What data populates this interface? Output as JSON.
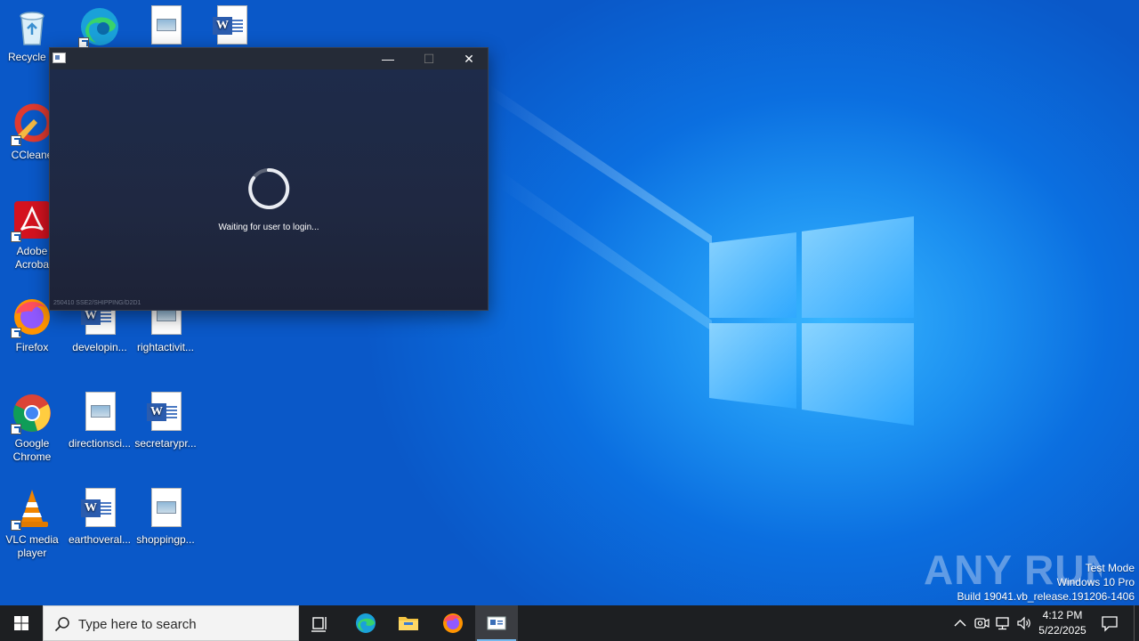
{
  "desktop": {
    "icons": [
      {
        "label": "Recycle Bin",
        "label_visible": "Recycle B"
      },
      {
        "label": "Microsoft Edge"
      },
      {
        "label": "",
        "type": "image-doc"
      },
      {
        "label": "",
        "type": "word-doc"
      },
      {
        "label": "CCleaner",
        "label_visible": "CCleane"
      },
      {
        "label": "Adobe Acrobat",
        "label_line1": "Adobe",
        "label_line2": "Acroba"
      },
      {
        "label": "Firefox"
      },
      {
        "label": "developin..."
      },
      {
        "label": "rightactivit..."
      },
      {
        "label": "Google Chrome",
        "label_line1": "Google",
        "label_line2": "Chrome"
      },
      {
        "label": "directionsci..."
      },
      {
        "label": "secretarypr..."
      },
      {
        "label": "VLC media player",
        "label_line1": "VLC media",
        "label_line2": "player"
      },
      {
        "label": "earthoveral..."
      },
      {
        "label": "shoppingp..."
      }
    ]
  },
  "window": {
    "status_text": "Waiting for user to login...",
    "build_tag": "250410 SSE2/SHIPPING/D2D1",
    "minimize_symbol": "—",
    "maximize_symbol": "☐",
    "close_symbol": "✕"
  },
  "watermark": {
    "brand": "ANY RUN",
    "mode": "Test Mode",
    "os": "Windows 10 Pro",
    "build": "Build 19041.vb_release.191206-1406"
  },
  "taskbar": {
    "search_placeholder": "Type here to search",
    "time": "4:12 PM",
    "date": "5/22/2025"
  },
  "colors": {
    "accent": "#76b9ed",
    "taskbar": "#1d1f22",
    "window_body": "#1f2841"
  }
}
